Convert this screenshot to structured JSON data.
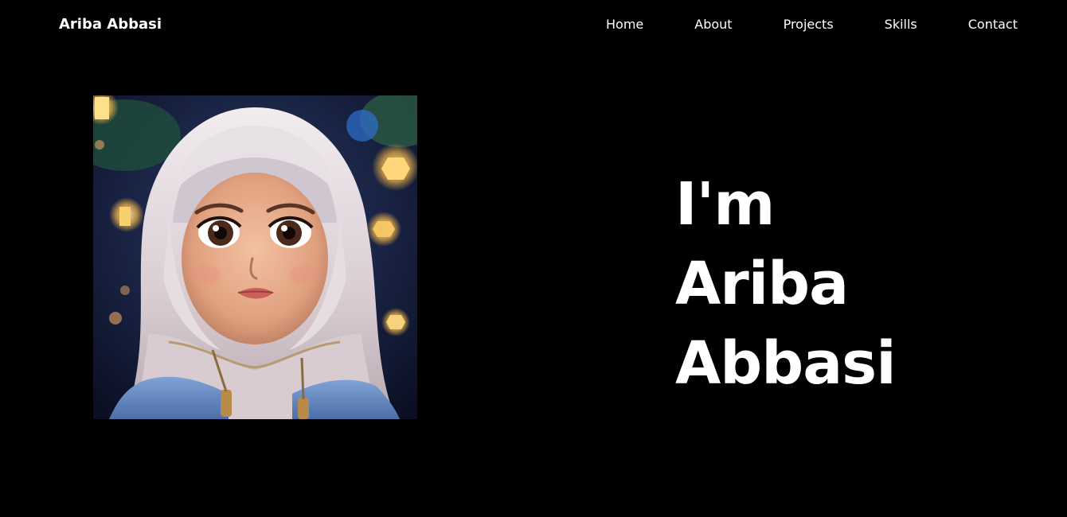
{
  "nav": {
    "brand": "Ariba Abbasi",
    "links": [
      {
        "label": "Home"
      },
      {
        "label": "About"
      },
      {
        "label": "Projects"
      },
      {
        "label": "Skills"
      },
      {
        "label": "Contact"
      }
    ]
  },
  "hero": {
    "title_lines": [
      "I'm",
      "Ariba",
      "Abbasi"
    ],
    "portrait_icon": "avatar-illustration-girl-in-hijab"
  },
  "colors": {
    "background": "#000000",
    "text": "#ffffff"
  }
}
